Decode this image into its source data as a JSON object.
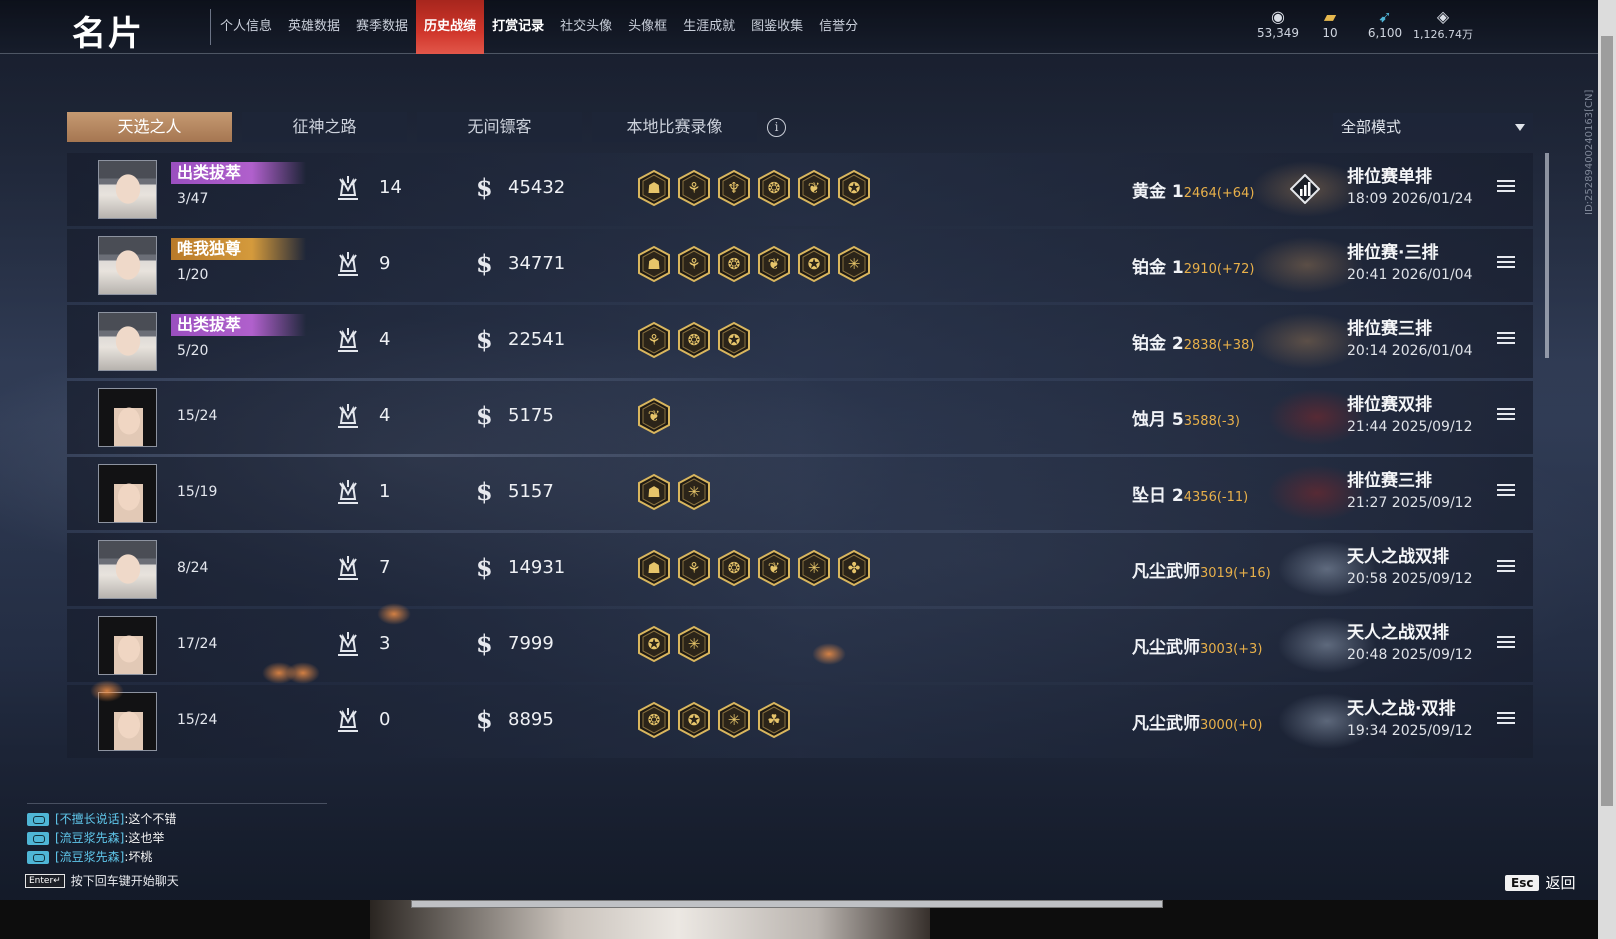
{
  "header": {
    "title": "名片",
    "nav": [
      {
        "label": "个人信息",
        "state": "normal",
        "dot": false
      },
      {
        "label": "英雄数据",
        "state": "normal",
        "dot": false
      },
      {
        "label": "赛季数据",
        "state": "normal",
        "dot": false
      },
      {
        "label": "历史战绩",
        "state": "active",
        "dot": false
      },
      {
        "label": "打赏记录",
        "state": "bold",
        "dot": false
      },
      {
        "label": "社交头像",
        "state": "normal",
        "dot": false
      },
      {
        "label": "头像框",
        "state": "normal",
        "dot": false
      },
      {
        "label": "生涯成就",
        "state": "normal",
        "dot": true
      },
      {
        "label": "图鉴收集",
        "state": "normal",
        "dot": true
      },
      {
        "label": "信誉分",
        "state": "normal",
        "dot": false
      }
    ],
    "currencies": [
      {
        "icon": "coin-stack-icon",
        "value": "53,349"
      },
      {
        "icon": "ticket-icon",
        "value": "10"
      },
      {
        "icon": "feather-icon",
        "value": "6,100"
      },
      {
        "icon": "diamond-icon",
        "value": "1,126.74万"
      }
    ]
  },
  "tabs": [
    {
      "label": "天选之人",
      "active": true
    },
    {
      "label": "征神之路",
      "active": false
    },
    {
      "label": "无间镖客",
      "active": false
    },
    {
      "label": "本地比赛录像",
      "active": false
    }
  ],
  "filter": {
    "selected": "全部模式"
  },
  "side_id": "ID:2528940024016​3[CN]",
  "matches": [
    {
      "avatar": "masked",
      "title": "出类拔萃",
      "title_color": "purple",
      "placement": "3/47",
      "crowns": "14",
      "score": "45432",
      "medals": [
        "☗",
        "⚘",
        "♆",
        "❂",
        "❦",
        "✪"
      ],
      "rank": "黄金 1",
      "points": "2464(+64)",
      "deco": "gold",
      "stats": true,
      "mode": "排位赛单排",
      "datetime": "18:09  2026/01/24"
    },
    {
      "avatar": "masked",
      "title": "唯我独尊",
      "title_color": "gold",
      "placement": "1/20",
      "crowns": "9",
      "score": "34771",
      "medals": [
        "☗",
        "⚘",
        "❂",
        "❦",
        "✪",
        "✳"
      ],
      "rank": "铂金 1",
      "points": "2910(+72)",
      "deco": "gold",
      "stats": false,
      "mode": "排位赛·三排",
      "datetime": "20:41  2026/01/04"
    },
    {
      "avatar": "masked",
      "title": "出类拔萃",
      "title_color": "purple",
      "placement": "5/20",
      "crowns": "4",
      "score": "22541",
      "medals": [
        "⚘",
        "❂",
        "✪"
      ],
      "rank": "铂金 2",
      "points": "2838(+38)",
      "deco": "gold",
      "stats": false,
      "mode": "排位赛三排",
      "datetime": "20:14  2026/01/04"
    },
    {
      "avatar": "dark",
      "title": "",
      "title_color": "",
      "placement": "15/24",
      "crowns": "4",
      "score": "5175",
      "medals": [
        "❦"
      ],
      "rank": "蚀月 5",
      "points": "3588(-3)",
      "deco": "red",
      "stats": false,
      "mode": "排位赛双排",
      "datetime": "21:44  2025/09/12"
    },
    {
      "avatar": "dark",
      "title": "",
      "title_color": "",
      "placement": "15/19",
      "crowns": "1",
      "score": "5157",
      "medals": [
        "☗",
        "✳"
      ],
      "rank": "坠日 2",
      "points": "4356(-11)",
      "deco": "red",
      "stats": false,
      "mode": "排位赛三排",
      "datetime": "21:27  2025/09/12"
    },
    {
      "avatar": "masked",
      "title": "",
      "title_color": "",
      "placement": "8/24",
      "crowns": "7",
      "score": "14931",
      "medals": [
        "☗",
        "⚘",
        "❂",
        "❦",
        "✳",
        "✤"
      ],
      "rank": "凡尘武师",
      "points": "3019(+16)",
      "deco": "silver",
      "stats": false,
      "mode": "天人之战双排",
      "datetime": "20:58  2025/09/12"
    },
    {
      "avatar": "dark",
      "title": "",
      "title_color": "",
      "placement": "17/24",
      "crowns": "3",
      "score": "7999",
      "medals": [
        "✪",
        "✳"
      ],
      "rank": "凡尘武师",
      "points": "3003(+3)",
      "deco": "silver",
      "stats": false,
      "mode": "天人之战双排",
      "datetime": "20:48  2025/09/12"
    },
    {
      "avatar": "dark",
      "title": "",
      "title_color": "",
      "placement": "15/24",
      "crowns": "0",
      "score": "8895",
      "medals": [
        "❂",
        "✪",
        "✳",
        "☘"
      ],
      "rank": "凡尘武师",
      "points": "3000(+0)",
      "deco": "silver",
      "stats": false,
      "mode": "天人之战·双排",
      "datetime": "19:34  2025/09/12"
    }
  ],
  "chat": [
    {
      "name": "[不擅长说话]",
      "msg": "这个不错"
    },
    {
      "name": "[流豆浆先森]",
      "msg": "这也举"
    },
    {
      "name": "[流豆浆先森]",
      "msg": "坏桃"
    }
  ],
  "chat_hint": {
    "key": "Enter↵",
    "text": "按下回车键开始聊天"
  },
  "esc": {
    "key": "Esc",
    "label": "返回"
  }
}
